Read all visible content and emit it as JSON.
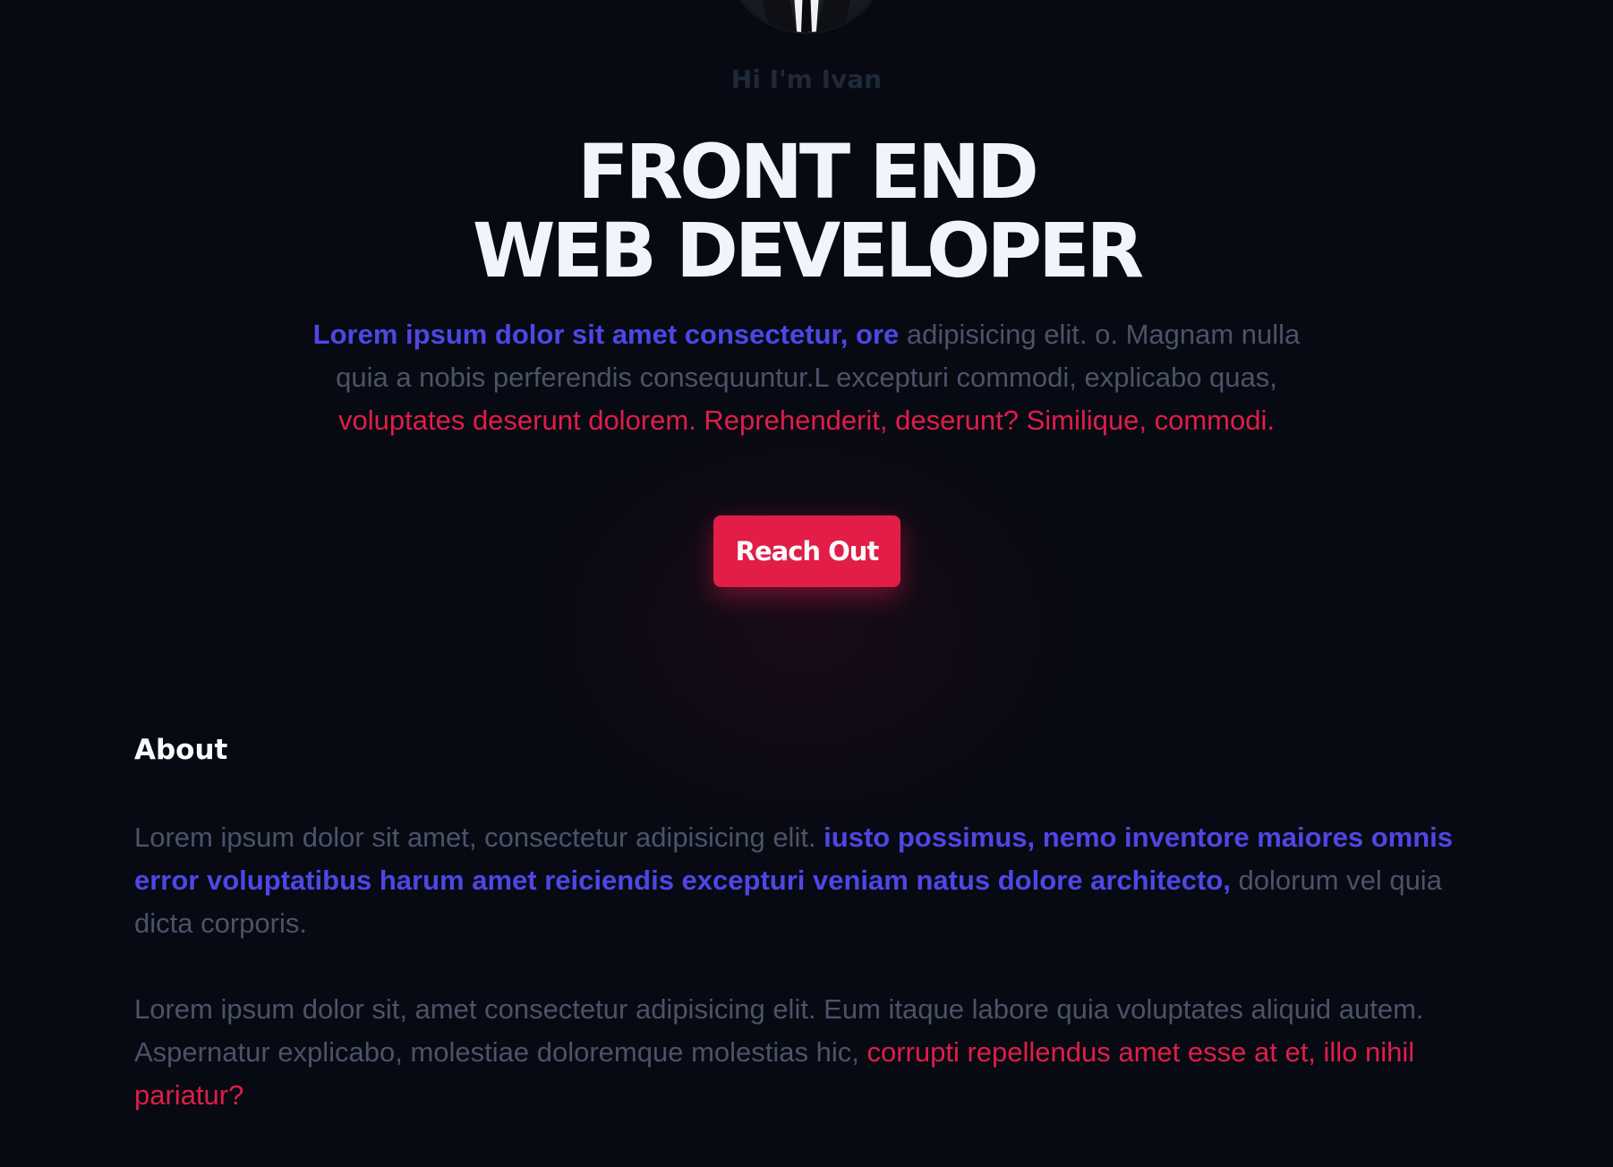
{
  "hero": {
    "greeting": "Hi I'm Ivan",
    "headline_line1": "FRONT END",
    "headline_line2": "WEB DEVELOPER",
    "intro_highlight": "Lorem ipsum dolor sit amet consectetur, ore",
    "intro_plain": " adipisicing elit. o. Magnam nulla quia a nobis perferendis consequuntur.L excepturi commodi, explicabo quas, ",
    "intro_accent": "voluptates deserunt dolorem. Reprehenderit, deserunt? Similique, commodi.",
    "cta_label": "Reach Out"
  },
  "about": {
    "title": "About",
    "p1_plain": "Lorem ipsum dolor sit amet, consectetur adipisicing elit. ",
    "p1_highlight": "iusto possimus, nemo inventore maiores omnis error voluptatibus harum amet reiciendis excepturi veniam natus dolore architecto,",
    "p1_tail": " dolorum vel quia dicta corporis.",
    "p2_plain": "Lorem ipsum dolor sit, amet consectetur adipisicing elit. Eum itaque labore quia voluptates aliquid autem. Aspernatur explicabo, molestiae doloremque molestias hic, ",
    "p2_accent": "corrupti repellendus amet esse at et, illo nihil pariatur?"
  },
  "colors": {
    "background": "#070a13",
    "accent_blue": "#4f46e5",
    "accent_red": "#e11d48",
    "muted_text": "#4b5368",
    "headline": "#f1f5fb"
  },
  "icons": {
    "avatar": "profile-photo"
  }
}
